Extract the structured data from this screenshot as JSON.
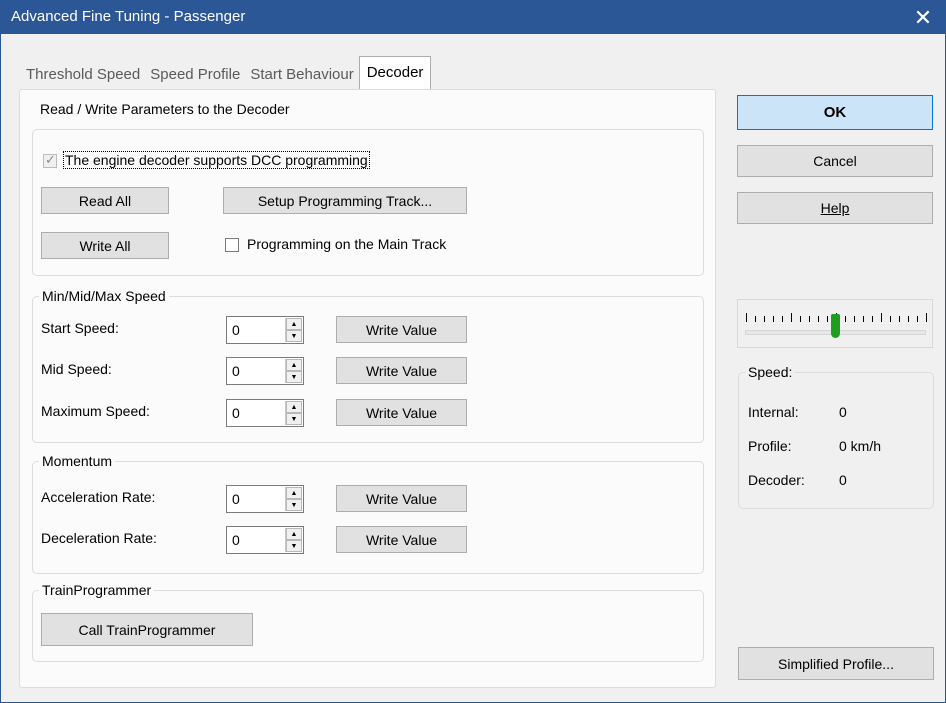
{
  "window": {
    "title": "Advanced Fine Tuning - Passenger",
    "close_glyph": "✕"
  },
  "tabs": [
    {
      "label": "Threshold Speed",
      "active": false
    },
    {
      "label": "Speed Profile",
      "active": false
    },
    {
      "label": "Start Behaviour",
      "active": false
    },
    {
      "label": "Decoder",
      "active": true
    }
  ],
  "read_write": {
    "group_title": "Read / Write Parameters to the Decoder",
    "dcc_checkbox_label": "The engine decoder supports DCC programming",
    "dcc_checked": true,
    "read_all": "Read All",
    "write_all": "Write All",
    "setup_track": "Setup Programming Track...",
    "main_track_label": "Programming on the Main Track",
    "main_track_checked": false
  },
  "speed_group": {
    "title": "Min/Mid/Max Speed",
    "rows": [
      {
        "label": "Start Speed:",
        "value": "0",
        "button": "Write Value"
      },
      {
        "label": "Mid Speed:",
        "value": "0",
        "button": "Write Value"
      },
      {
        "label": "Maximum Speed:",
        "value": "0",
        "button": "Write Value"
      }
    ]
  },
  "momentum_group": {
    "title": "Momentum",
    "rows": [
      {
        "label": "Acceleration Rate:",
        "value": "0",
        "button": "Write Value"
      },
      {
        "label": "Deceleration Rate:",
        "value": "0",
        "button": "Write Value"
      }
    ]
  },
  "trainprogrammer": {
    "title": "TrainProgrammer",
    "button": "Call TrainProgrammer"
  },
  "right_panel": {
    "ok": "OK",
    "cancel": "Cancel",
    "help": "Help",
    "slider_level": 0.5,
    "speed_title": "Speed:",
    "internal_label": "Internal:",
    "internal_value": "0",
    "profile_label": "Profile:",
    "profile_value": "0 km/h",
    "decoder_label": "Decoder:",
    "decoder_value": "0",
    "simplified_profile": "Simplified Profile..."
  },
  "colors": {
    "titlebar": "#2b5797",
    "thumb": "#1e9e1e",
    "ok_bg": "#cce4f7"
  }
}
